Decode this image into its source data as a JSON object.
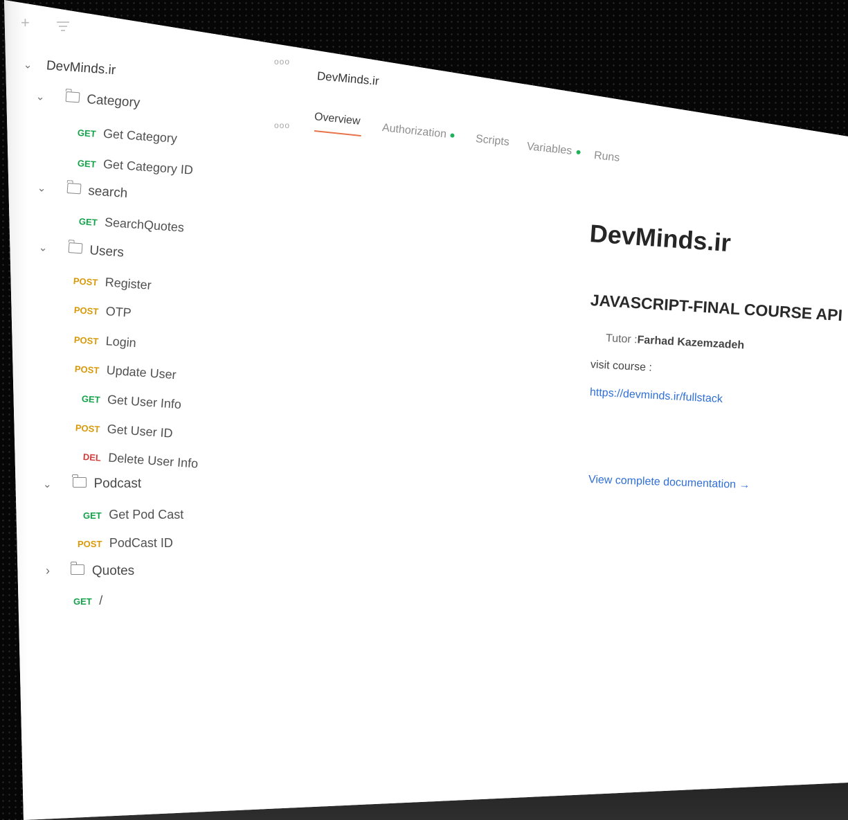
{
  "toolbar": {
    "new_icon": "plus-icon",
    "filter_icon": "filter-icon"
  },
  "sidebar": {
    "root": {
      "label": "DevMinds.ir",
      "more": "ooo"
    },
    "folders": [
      {
        "label": "Category",
        "expanded": true,
        "more": "ooo",
        "requests": [
          {
            "method": "GET",
            "label": "Get Category"
          },
          {
            "method": "GET",
            "label": "Get Category ID"
          }
        ]
      },
      {
        "label": "search",
        "expanded": true,
        "requests": [
          {
            "method": "GET",
            "label": "SearchQuotes"
          }
        ]
      },
      {
        "label": "Users",
        "expanded": true,
        "requests": [
          {
            "method": "POST",
            "label": "Register"
          },
          {
            "method": "POST",
            "label": "OTP"
          },
          {
            "method": "POST",
            "label": "Login"
          },
          {
            "method": "POST",
            "label": "Update User"
          },
          {
            "method": "GET",
            "label": "Get User Info"
          },
          {
            "method": "POST",
            "label": "Get User ID"
          },
          {
            "method": "DEL",
            "label": "Delete User Info"
          }
        ]
      },
      {
        "label": "Podcast",
        "expanded": true,
        "requests": [
          {
            "method": "GET",
            "label": "Get Pod Cast"
          },
          {
            "method": "POST",
            "label": "PodCast ID"
          }
        ]
      },
      {
        "label": "Quotes",
        "expanded": false,
        "requests": []
      }
    ],
    "root_request": {
      "method": "GET",
      "label": "/"
    }
  },
  "header": {
    "title": "DevMinds.ir"
  },
  "tabs": [
    {
      "label": "Overview",
      "active": true,
      "indicator": false
    },
    {
      "label": "Authorization",
      "active": false,
      "indicator": true
    },
    {
      "label": "Scripts",
      "active": false,
      "indicator": false
    },
    {
      "label": "Variables",
      "active": false,
      "indicator": true
    },
    {
      "label": "Runs",
      "active": false,
      "indicator": false
    }
  ],
  "doc": {
    "title": "DevMinds.ir",
    "subtitle": "JAVASCRIPT-FINAL COURSE API",
    "tutor_prefix": "Tutor :",
    "tutor_name": "Farhad Kazemzadeh",
    "visit": "visit course :",
    "link": "https://devminds.ir/fullstack",
    "view_docs": "View complete documentation →"
  },
  "colors": {
    "get": "#14a34a",
    "post": "#d89a0a",
    "del": "#d43b3b",
    "accent": "#e8734a",
    "link": "#2f6fd6"
  }
}
